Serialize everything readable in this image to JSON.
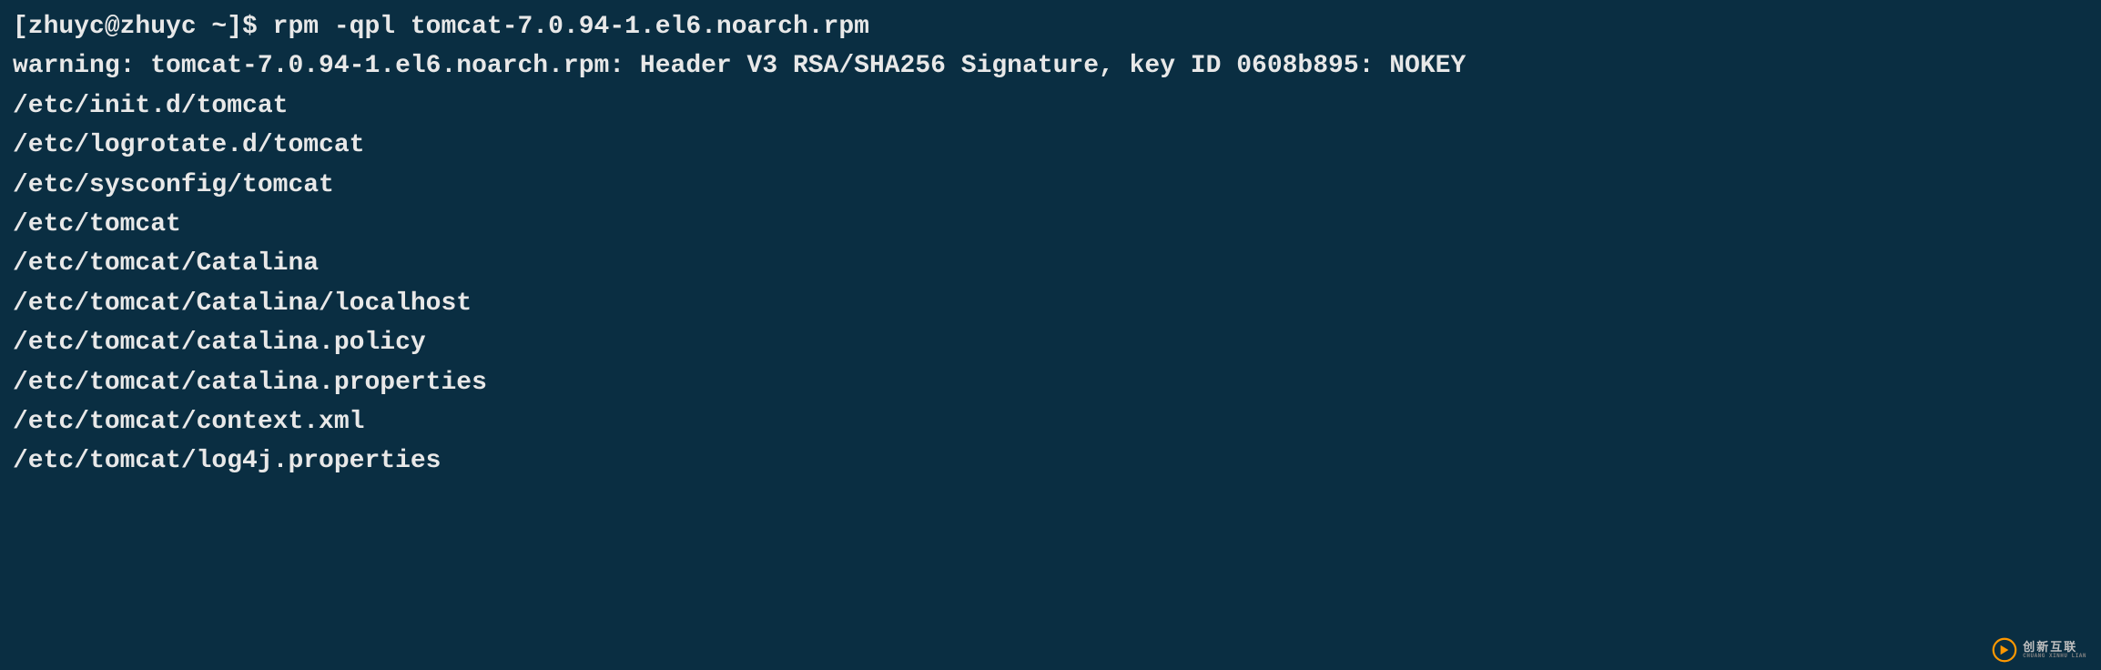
{
  "terminal": {
    "prompt": "[zhuyc@zhuyc ~]$ ",
    "command": "rpm -qpl tomcat-7.0.94-1.el6.noarch.rpm",
    "lines": [
      "warning: tomcat-7.0.94-1.el6.noarch.rpm: Header V3 RSA/SHA256 Signature, key ID 0608b895: NOKEY",
      "/etc/init.d/tomcat",
      "/etc/logrotate.d/tomcat",
      "/etc/sysconfig/tomcat",
      "/etc/tomcat",
      "/etc/tomcat/Catalina",
      "/etc/tomcat/Catalina/localhost",
      "/etc/tomcat/catalina.policy",
      "/etc/tomcat/catalina.properties",
      "/etc/tomcat/context.xml",
      "/etc/tomcat/log4j.properties"
    ]
  },
  "watermark": {
    "main": "创新互联",
    "sub": "CHUANG XINHU LIAN"
  }
}
